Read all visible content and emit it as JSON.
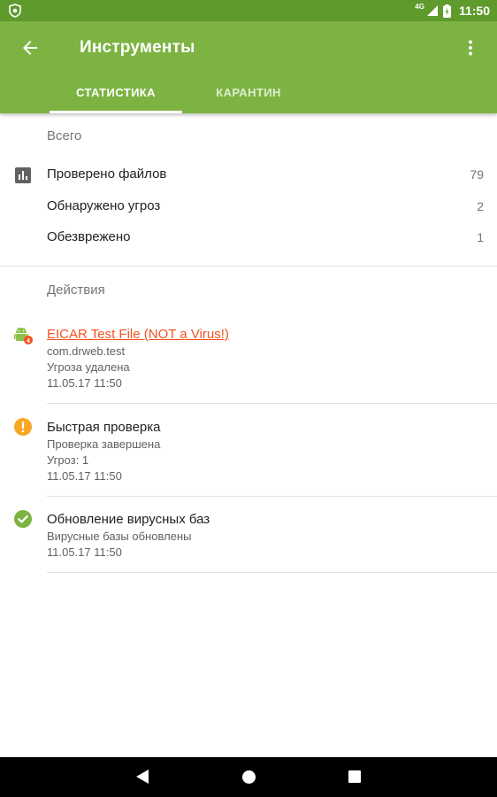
{
  "status_bar": {
    "network": "4G",
    "time": "11:50"
  },
  "app_bar": {
    "title": "Инструменты"
  },
  "tabs": [
    {
      "label": "СТАТИСТИКА"
    },
    {
      "label": "КАРАНТИН"
    }
  ],
  "stats": {
    "section_title": "Всего",
    "rows": [
      {
        "label": "Проверено файлов",
        "value": "79"
      },
      {
        "label": "Обнаружено угроз",
        "value": "2"
      },
      {
        "label": "Обезврежено",
        "value": "1"
      }
    ]
  },
  "actions": {
    "section_title": "Действия",
    "items": [
      {
        "title": "EICAR Test File (NOT a Virus!)",
        "lines": [
          "com.drweb.test",
          "Угроза удалена",
          "11.05.17 11:50"
        ],
        "icon": "android-threat-icon"
      },
      {
        "title": "Быстрая проверка",
        "lines": [
          "Проверка завершена",
          "Угроз: 1",
          "11.05.17 11:50"
        ],
        "icon": "warning-icon"
      },
      {
        "title": "Обновление вирусных баз",
        "lines": [
          "Вирусные базы обновлены",
          "11.05.17 11:50"
        ],
        "icon": "check-circle-icon"
      }
    ]
  },
  "colors": {
    "status_bar": "#5f9a2d",
    "app_bar": "#7cb342",
    "threat_text": "#f4511e",
    "warning": "#f9a825",
    "success": "#7cb342"
  }
}
